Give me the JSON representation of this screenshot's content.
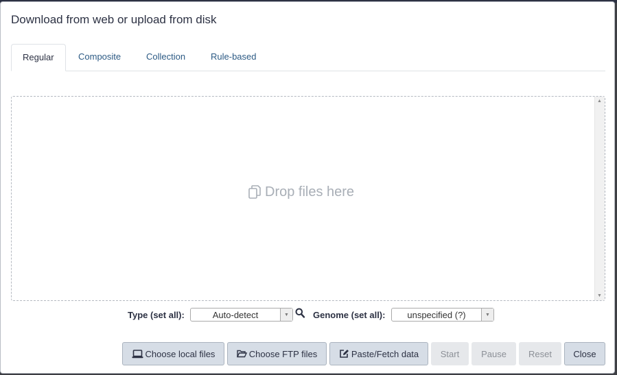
{
  "modal": {
    "title": "Download from web or upload from disk"
  },
  "tabs": [
    {
      "label": "Regular",
      "active": true
    },
    {
      "label": "Composite",
      "active": false
    },
    {
      "label": "Collection",
      "active": false
    },
    {
      "label": "Rule-based",
      "active": false
    }
  ],
  "dropzone": {
    "icon": "copy-files-icon",
    "message": "Drop files here"
  },
  "settings": {
    "type_label": "Type (set all):",
    "type_value": "Auto-detect",
    "genome_label": "Genome (set all):",
    "genome_value": "unspecified (?)"
  },
  "buttons": {
    "choose_local": "Choose local files",
    "choose_ftp": "Choose FTP files",
    "paste_fetch": "Paste/Fetch data",
    "start": "Start",
    "pause": "Pause",
    "reset": "Reset",
    "close": "Close"
  },
  "colors": {
    "accent_link": "#2c5a84",
    "button_bg": "#d6dde6",
    "disabled_bg": "#e6e8eb"
  }
}
